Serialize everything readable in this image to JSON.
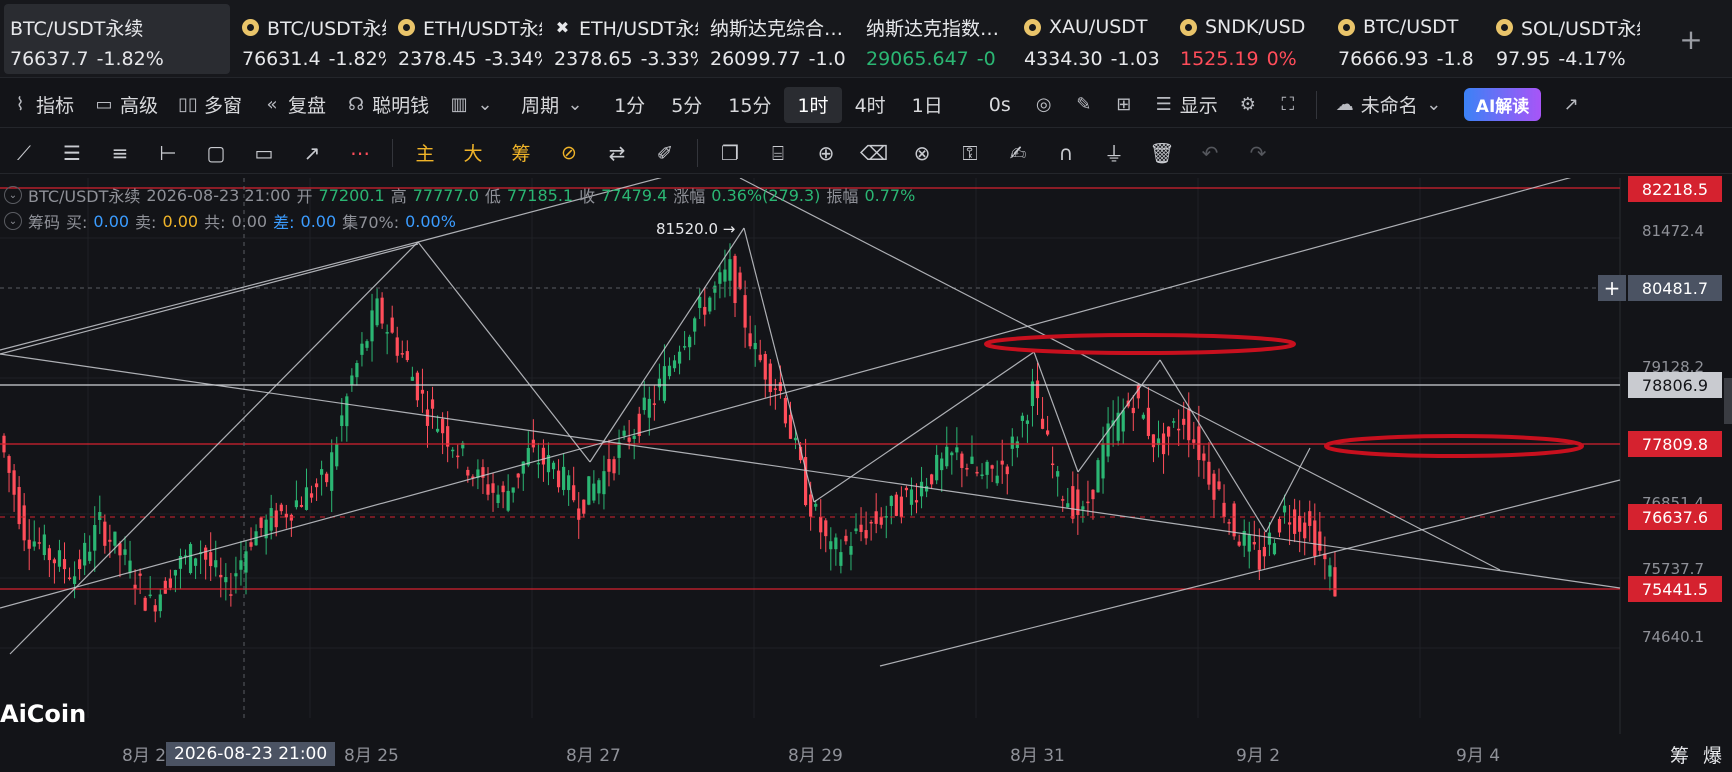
{
  "tickers": [
    {
      "name": "BTC/USDT永续",
      "price": "76637.7",
      "change": "-1.82%",
      "icon": "none",
      "active": true,
      "priceColor": "",
      "changeColor": ""
    },
    {
      "name": "BTC/USDT永续",
      "price": "76631.4",
      "change": "-1.82%",
      "icon": "coin-icon",
      "active": false,
      "priceColor": "",
      "changeColor": ""
    },
    {
      "name": "ETH/USDT永续",
      "price": "2378.45",
      "change": "-3.34%",
      "icon": "coin-icon",
      "active": false,
      "priceColor": "",
      "changeColor": ""
    },
    {
      "name": "ETH/USDT永续",
      "price": "2378.65",
      "change": "-3.33%",
      "icon": "x-icon",
      "active": false,
      "priceColor": "",
      "changeColor": ""
    },
    {
      "name": "纳斯达克综合…",
      "price": "26099.77",
      "change": "-1.0",
      "icon": "none",
      "active": false,
      "priceColor": "",
      "changeColor": ""
    },
    {
      "name": "纳斯达克指数…",
      "price": "29065.647",
      "change": "-0",
      "icon": "none",
      "active": false,
      "priceColor": "green",
      "changeColor": "green"
    },
    {
      "name": "XAU/USDT",
      "price": "4334.30",
      "change": "-1.03",
      "icon": "coin-icon",
      "active": false,
      "priceColor": "",
      "changeColor": ""
    },
    {
      "name": "SNDK/USD",
      "price": "1525.19",
      "change": "0%",
      "icon": "coin-icon",
      "active": false,
      "priceColor": "red",
      "changeColor": "red"
    },
    {
      "name": "BTC/USDT",
      "price": "76666.93",
      "change": "-1.8",
      "icon": "coin-icon",
      "active": false,
      "priceColor": "",
      "changeColor": ""
    },
    {
      "name": "SOL/USDT永续",
      "price": "97.95",
      "change": "-4.17%",
      "icon": "coin-icon",
      "active": false,
      "priceColor": "",
      "changeColor": ""
    }
  ],
  "toolbar": {
    "indicators": "指标",
    "advanced": "高级",
    "multi_window": "多窗",
    "replay": "复盘",
    "smart_money": "聪明钱",
    "period": "周期",
    "intervals": [
      "1分",
      "5分",
      "15分",
      "1时",
      "4时",
      "1日"
    ],
    "active_interval": "1时",
    "countdown": "0s",
    "display": "显示",
    "layout_name": "未命名",
    "ai_button": "AI解读"
  },
  "draw_tools": {
    "main": "主",
    "big": "大",
    "chips": "筹"
  },
  "legend": {
    "symbol": "BTC/USDT永续",
    "datetime": "2026-08-23 21:00",
    "open_label": "开",
    "open": "77200.1",
    "high_label": "高",
    "high": "77777.0",
    "low_label": "低",
    "low": "77185.1",
    "close_label": "收",
    "close": "77479.4",
    "change_label": "涨幅",
    "change": "0.36%(279.3)",
    "amp_label": "振幅",
    "amp": "0.77%",
    "chips_label": "筹码",
    "buy_label": "买:",
    "buy": "0.00",
    "sell_label": "卖:",
    "sell": "0.00",
    "total_label": "共:",
    "total": "0.00",
    "diff_label": "差:",
    "diff": "0.00",
    "conc_label": "集70%:",
    "conc": "0.00%"
  },
  "price_tags": {
    "r1": "82218.5",
    "cross": "80481.7",
    "white": "78806.9",
    "r2": "77809.8",
    "last": "76637.6",
    "r3": "75441.5"
  },
  "price_axis": [
    "81472.4",
    "79128.2",
    "76851.4",
    "75737.7",
    "74640.1"
  ],
  "time_axis": [
    "8月 23",
    "8月 25",
    "8月 27",
    "8月 29",
    "8月 31",
    "9月 2",
    "9月 4"
  ],
  "crosshair_time": "2026-08-23 21:00",
  "peak_label": "81520.0 →",
  "logo": "AiCoin",
  "corner": [
    "筹",
    "爆"
  ],
  "colors": {
    "up": "#2bb673",
    "down": "#ff4d5a",
    "resist": "#d5222f",
    "trend": "#c9cbd0",
    "bg": "#131418"
  },
  "chart_data": {
    "type": "line",
    "series": [
      {
        "values": [
          78900,
          77400,
          77000,
          76700,
          77500,
          76900,
          76200,
          76800,
          77100,
          76400,
          77300,
          77600,
          77900,
          78200,
          79800,
          80900,
          80200,
          79300,
          78800,
          78200,
          77900,
          78600,
          78400,
          77800,
          78300,
          78900,
          79500,
          80400,
          81000,
          81520,
          80200,
          79600,
          78000,
          77000,
          77300,
          77600,
          77900,
          78300,
          78600,
          78200,
          78500,
          79600,
          78100,
          77600,
          78900,
          79500,
          78700,
          79200,
          78300,
          77400,
          76900,
          77700,
          77400,
          76500
        ]
      }
    ],
    "y_range": [
      74400,
      83000
    ]
  }
}
